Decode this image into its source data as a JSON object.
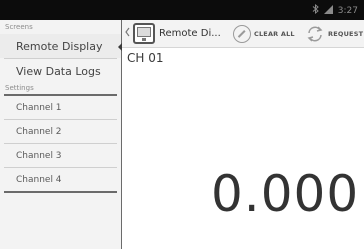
{
  "status_bar": {
    "time": "3:27",
    "icons": [
      "bluetooth-icon",
      "signal-icon",
      "battery-icon"
    ]
  },
  "sidebar": {
    "screens_header": "Screens",
    "screens": [
      {
        "label": "Remote Display",
        "selected": true
      },
      {
        "label": "View Data Logs",
        "selected": false
      }
    ],
    "settings_header": "Settings",
    "settings": [
      {
        "label": "Channel 1"
      },
      {
        "label": "Channel 2"
      },
      {
        "label": "Channel 3"
      },
      {
        "label": "Channel 4"
      }
    ]
  },
  "action_bar": {
    "title": "Remote Di...",
    "clear_all_label": "CLEAR ALL",
    "request_label": "REQUEST"
  },
  "main": {
    "channel_label": "CH 01",
    "value": "0.000"
  },
  "colors": {
    "status_bar_bg": "#0c0c0c",
    "sidebar_bg": "#f3f3f3",
    "text": "#333333"
  }
}
